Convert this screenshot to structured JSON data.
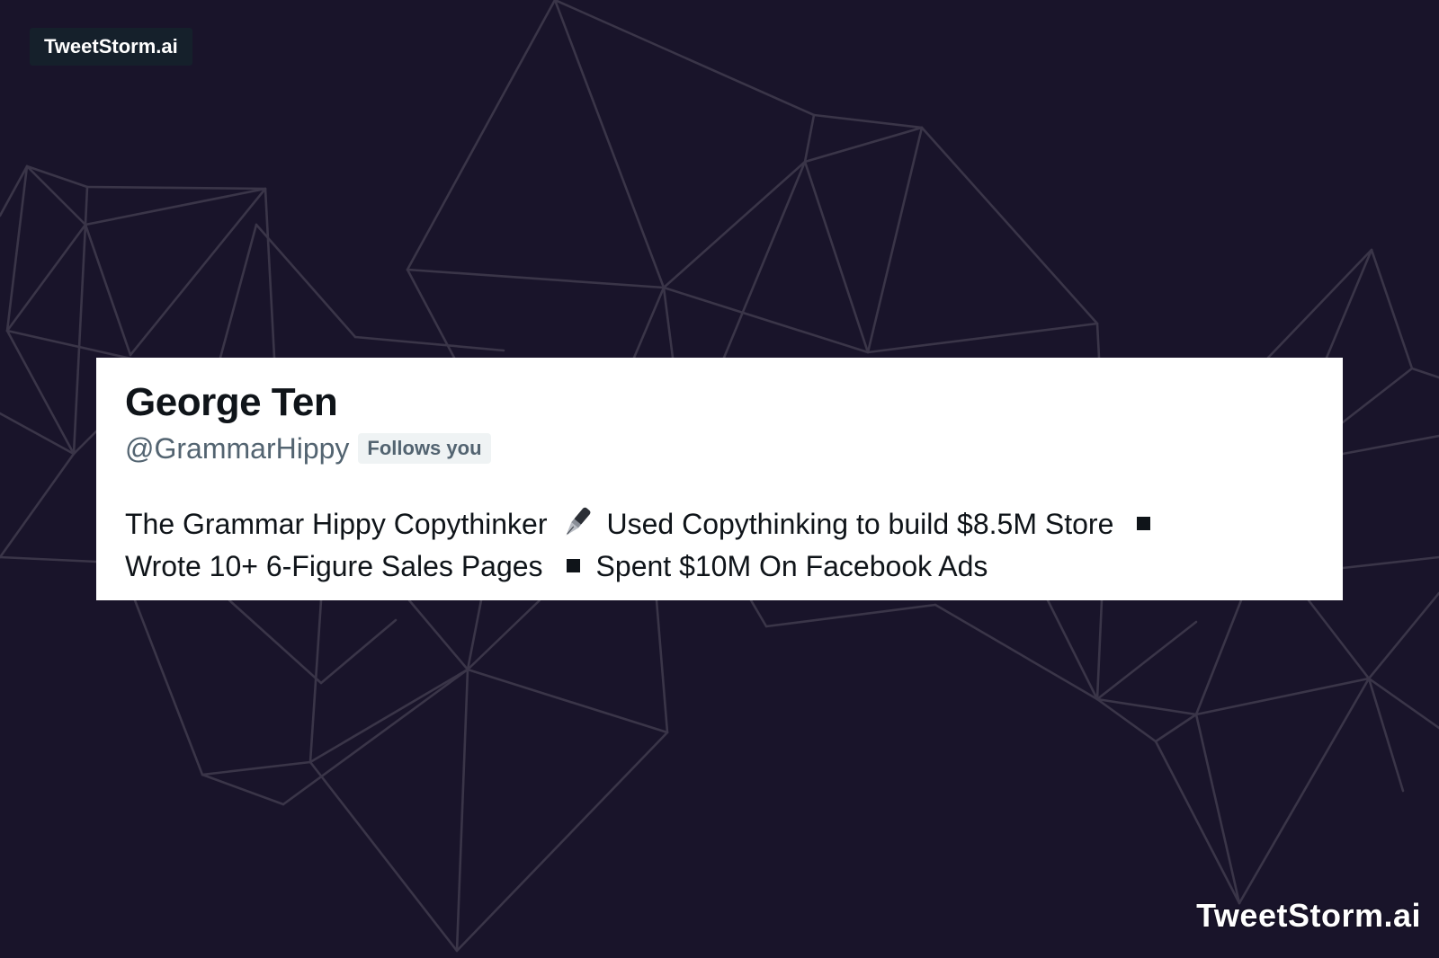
{
  "brand": {
    "top_label": "TweetStorm.ai",
    "bottom_label": "TweetStorm.ai"
  },
  "profile": {
    "display_name": "George Ten",
    "handle": "@GrammarHippy",
    "follows_badge": "Follows you",
    "bio": {
      "part1": "The Grammar Hippy Copythinker",
      "part2": "Used Copythinking to build $8.5M Store",
      "part3": "Wrote 10+ 6-Figure Sales Pages",
      "part4": "Spent $10M On Facebook Ads"
    },
    "icons": {
      "pen": "fountain-pen-icon",
      "bullet": "black-square-icon"
    }
  },
  "colors": {
    "background": "#19142a",
    "mesh_lines": "#3a3548",
    "card": "#ffffff",
    "name_text": "#0f1419",
    "secondary_text": "#536471",
    "badge_bg": "#eff3f4"
  }
}
